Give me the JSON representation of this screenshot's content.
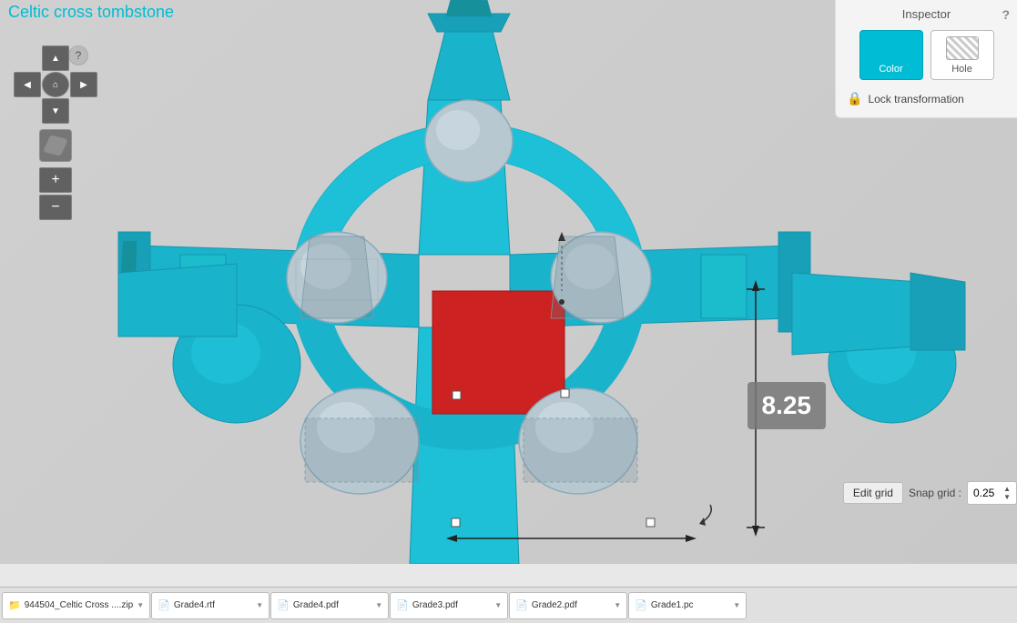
{
  "title": "Celtic cross tombstone",
  "viewport": {
    "background": "#d0d0d0"
  },
  "controls": {
    "help_label": "?",
    "nav_up": "▲",
    "nav_down": "▼",
    "nav_left": "◀",
    "nav_right": "▶",
    "nav_center": "⌂",
    "zoom_in": "+",
    "zoom_out": "−"
  },
  "inspector": {
    "title": "Inspector",
    "help": "?",
    "color_label": "Color",
    "hole_label": "Hole",
    "lock_transformation": "Lock transformation"
  },
  "measurement": {
    "value": "8.25"
  },
  "snap_grid": {
    "edit_grid_label": "Edit grid",
    "snap_grid_label": "Snap grid :",
    "value": "0.25"
  },
  "taskbar": {
    "items": [
      {
        "icon": "📁",
        "label": "944504_Celtic Cross ....zip",
        "type": "zip"
      },
      {
        "icon": "📄",
        "label": "Grade4.rtf",
        "type": "rtf"
      },
      {
        "icon": "📄",
        "label": "Grade4.pdf",
        "type": "pdf"
      },
      {
        "icon": "📄",
        "label": "Grade3.pdf",
        "type": "pdf"
      },
      {
        "icon": "📄",
        "label": "Grade2.pdf",
        "type": "pdf"
      },
      {
        "icon": "📄",
        "label": "Grade1.pc",
        "type": "pc"
      }
    ]
  }
}
